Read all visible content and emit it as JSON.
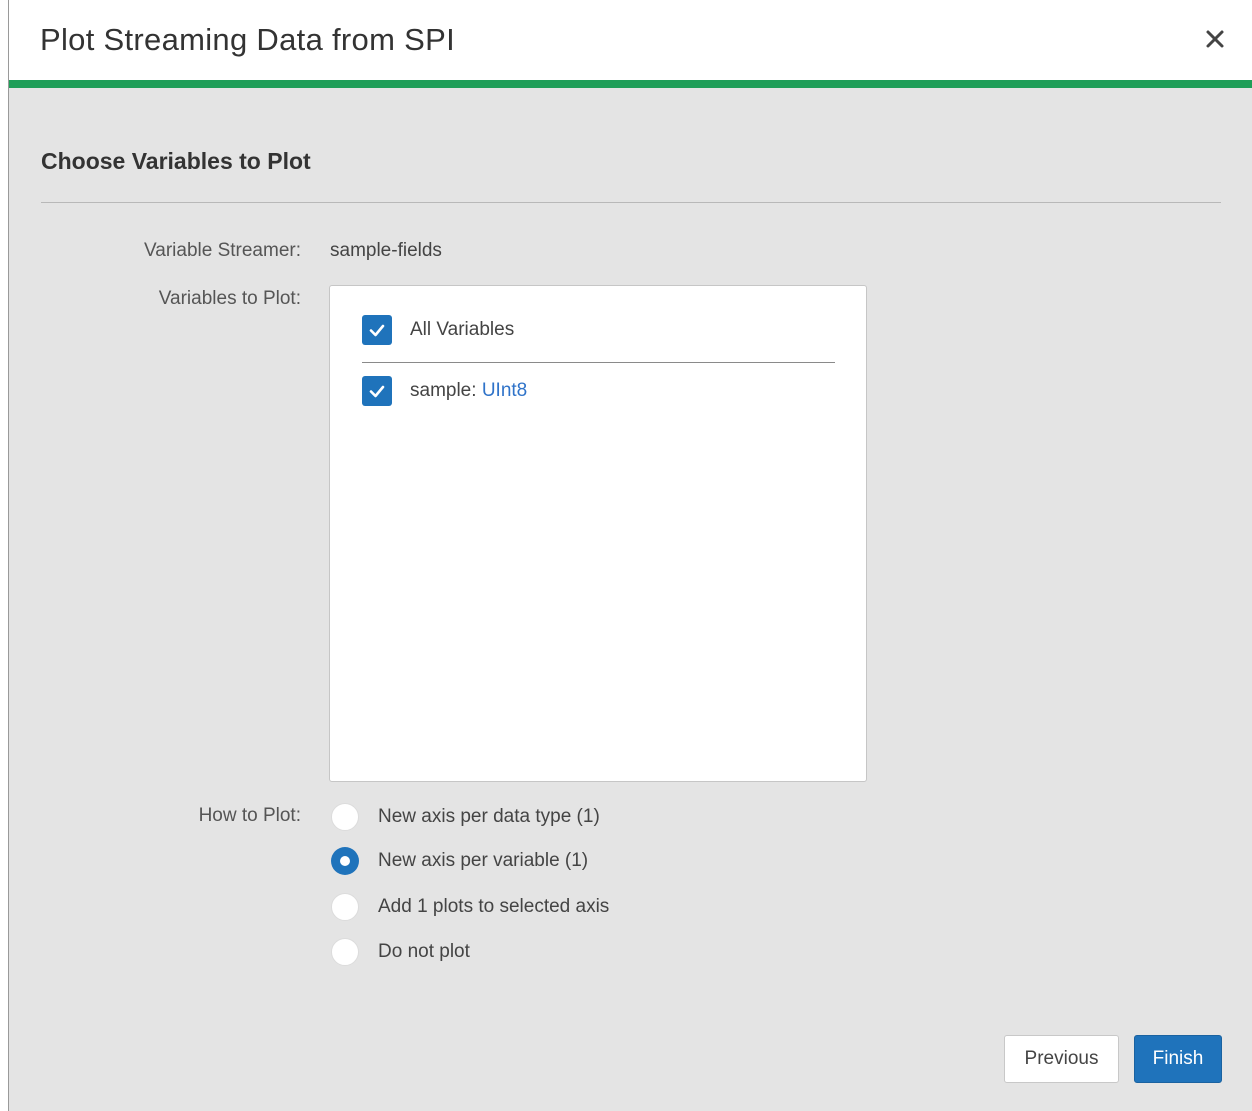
{
  "dialog": {
    "title": "Plot Streaming Data from SPI",
    "close_icon": "close-icon",
    "accent_color": "#1f9e58"
  },
  "section": {
    "heading": "Choose Variables to Plot"
  },
  "variable_streamer": {
    "label": "Variable Streamer:",
    "value": "sample-fields"
  },
  "variables_to_plot": {
    "label": "Variables to Plot:",
    "all_variables": {
      "label": "All Variables",
      "checked": true
    },
    "items": [
      {
        "name": "sample:",
        "type": "UInt8",
        "checked": true
      }
    ]
  },
  "how_to_plot": {
    "label": "How to Plot:",
    "options": [
      {
        "label": "New axis per data type (1)",
        "selected": false
      },
      {
        "label": "New axis per variable (1)",
        "selected": true
      },
      {
        "label": "Add 1 plots to selected axis",
        "selected": false
      },
      {
        "label": "Do not plot",
        "selected": false
      }
    ]
  },
  "buttons": {
    "previous": "Previous",
    "finish": "Finish"
  },
  "colors": {
    "primary": "#1f73bb",
    "link": "#2f73c9",
    "background": "#e4e4e4"
  }
}
